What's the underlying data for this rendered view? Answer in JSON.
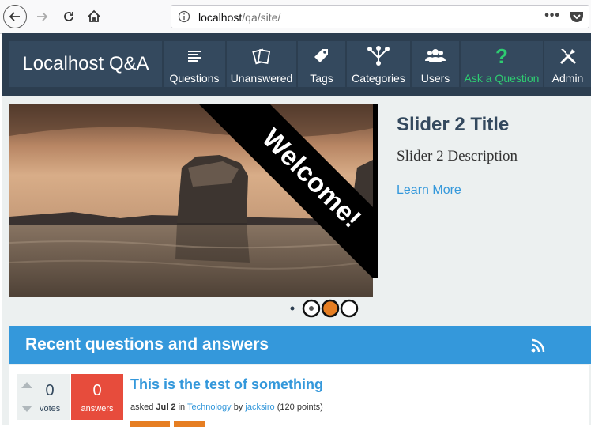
{
  "browser": {
    "url_host": "localhost",
    "url_path": "/qa/site/",
    "menu_dots": "•••"
  },
  "site": {
    "logo": "Localhost Q&A",
    "nav": [
      {
        "label": "Questions",
        "icon": "questions-icon"
      },
      {
        "label": "Unanswered",
        "icon": "unanswered-icon"
      },
      {
        "label": "Tags",
        "icon": "tag-icon"
      },
      {
        "label": "Categories",
        "icon": "categories-icon"
      },
      {
        "label": "Users",
        "icon": "users-icon"
      },
      {
        "label": "Ask a Question",
        "icon": "question-mark-icon"
      },
      {
        "label": "Admin",
        "icon": "tools-icon"
      }
    ],
    "colors": {
      "topbar": "#2c3e50",
      "nav_item": "#34495e",
      "accent_blue": "#3498db",
      "ask_green": "#2ecc71",
      "answers_red": "#e74c3c",
      "tag_orange": "#e67e22"
    }
  },
  "slider": {
    "ribbon": "Welcome!",
    "title": "Slider 2 Title",
    "description": "Slider 2 Description",
    "link": "Learn More",
    "active_dot": 2
  },
  "recent": {
    "heading": "Recent questions and answers",
    "questions": [
      {
        "votes": "0",
        "votes_label": "votes",
        "answers": "0",
        "answers_label": "answers",
        "title": "This is the test of something",
        "asked": "asked",
        "date": "Jul 2",
        "in": "in",
        "category": "Technology",
        "by": "by",
        "user": "jacksiro",
        "points": "(120 points)"
      }
    ]
  }
}
